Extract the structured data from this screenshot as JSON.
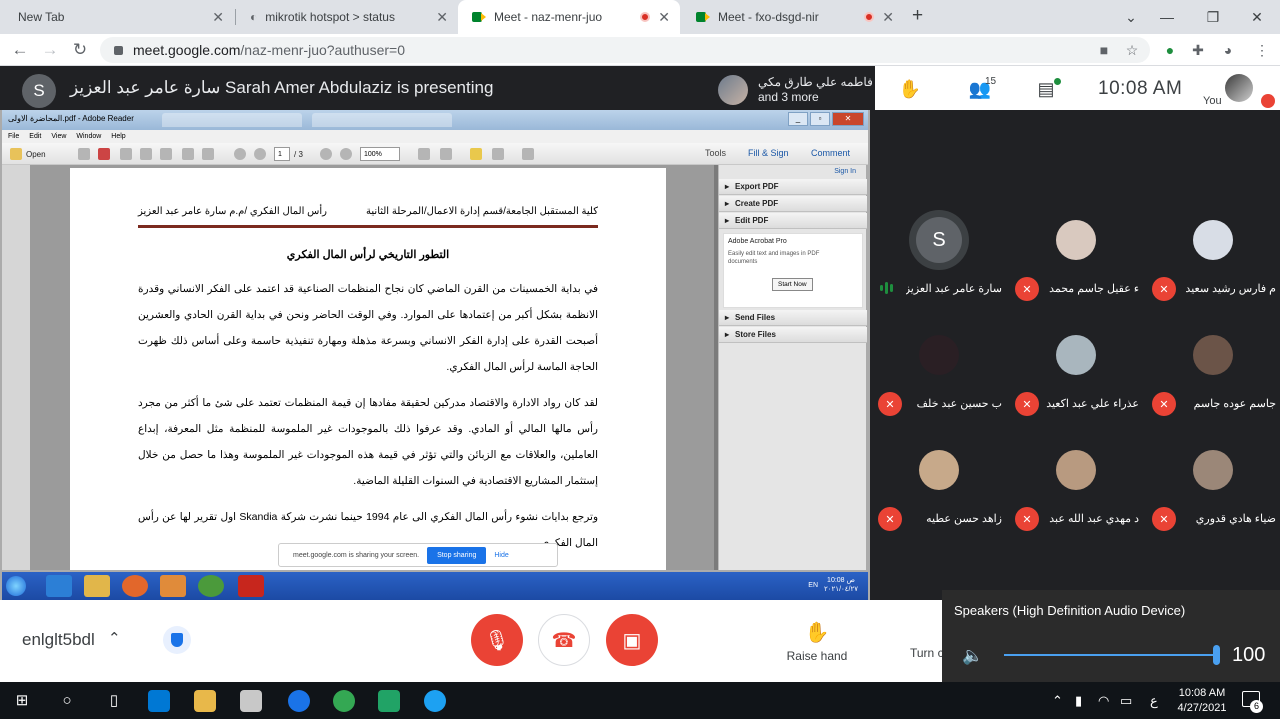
{
  "browser": {
    "tabs": [
      {
        "title": "New Tab",
        "active": false
      },
      {
        "title": "mikrotik hotspot > status",
        "active": false
      },
      {
        "title": "Meet - naz-menr-juo",
        "active": true,
        "recording": true
      },
      {
        "title": "Meet - fxo-dsgd-nir",
        "active": false,
        "recording": true
      }
    ],
    "new_tab_symbol": "+",
    "url_host": "meet.google.com",
    "url_path": "/naz-menr-juo?authuser=0"
  },
  "meet": {
    "presenter_initial": "S",
    "presenting_text": "سارة عامر عبد العزيز Sarah Amer Abdulaziz is presenting",
    "others_line1": "فاطمه علي طارق مكي",
    "others_line2": "and 3 more",
    "participant_count": "15",
    "clock": "10:08 AM",
    "you_label": "You"
  },
  "shared_screen": {
    "window_title": "المحاضرة الاولى.pdf - Adobe Reader",
    "menu": [
      "File",
      "Edit",
      "View",
      "Window",
      "Help"
    ],
    "open_label": "Open",
    "page_current": "1",
    "page_total": "/ 3",
    "zoom": "100%",
    "tools_label": "Tools",
    "fill_sign_label": "Fill & Sign",
    "comment_label": "Comment",
    "sign_in": "Sign In",
    "panel_items": [
      "Export PDF",
      "Create PDF",
      "Edit PDF",
      "Send Files",
      "Store Files"
    ],
    "acrobat_title": "Adobe Acrobat Pro",
    "acrobat_desc": "Easily edit text and images in PDF documents",
    "start_now": "Start Now",
    "doc_header_right": "كلية المستقبل الجامعة/قسم إدارة الاعمال/المرحلة الثانية",
    "doc_header_left": "رأس المال الفكري /م.م سارة عامر عبد العزيز",
    "doc_heading": "التطور التاريخي لرأس المال الفكري",
    "para1": "في بداية الخمسينات من القرن الماضي كان نجاح المنظمات الصناعية قد اعتمد على الفكر الانساني وقدرة الانظمة بشكل أكبر من إعتمادها على الموارد. وفي الوقت الحاضر ونحن في بداية القرن الحادي والعشرين أصبحت القدرة على إدارة الفكر الانساني وبسرعة مذهلة ومهارة تنفيذية حاسمة وعلى أساس ذلك ظهرت الحاجة الماسة لرأس المال الفكري.",
    "para2": "لقد كان رواد الادارة والاقتصاد مدركين لحقيقة مفادها إن قيمة المنظمات تعتمد على شئ ما أكثر من مجرد رأس مالها المالي أو المادي. وقد عرفوا ذلك بالموجودات غير الملموسة للمنظمة مثل المعرفة، إبداع العاملين، والعلاقات مع الزبائن والتي تؤثر في قيمة هذه الموجودات غير الملموسة وهذا ما حصل من خلال إستثمار المشاريع الاقتصادية في السنوات القليلة الماضية.",
    "para3": "وترجع بدايات نشوء رأس المال الفكري الى عام 1994 حينما نشرت شركة Skandia اول تقرير لها عن رأس المال الفكري",
    "share_notice": "meet.google.com is sharing your screen.",
    "stop_sharing": "Stop sharing",
    "hide": "Hide",
    "xp_lang": "EN",
    "xp_time": "10:08 ص",
    "xp_date": "٢٠٢١/٠٤/٢٧"
  },
  "participants": [
    {
      "name": "سارة عامر عبد العزيز",
      "letter": "S",
      "speaking": true,
      "muted": false,
      "photo_color": "#5f6368"
    },
    {
      "name": "ء عقيل جاسم محمد",
      "letter": "",
      "speaking": false,
      "muted": true,
      "photo_color": "#d9c9bf"
    },
    {
      "name": "م فارس رشيد سعيد",
      "letter": "",
      "speaking": false,
      "muted": true,
      "photo_color": "#d8dde6"
    },
    {
      "name": "ب حسين عبد خلف",
      "letter": "",
      "speaking": false,
      "muted": true,
      "photo_color": "#2a1f24"
    },
    {
      "name": "عذراء علي عبد اكعيد",
      "letter": "",
      "speaking": false,
      "muted": true,
      "photo_color": "#a9b6be"
    },
    {
      "name": "جاسم عوده جاسم",
      "letter": "",
      "speaking": false,
      "muted": true,
      "photo_color": "#6b5448"
    },
    {
      "name": "زاهد حسن عطيه",
      "letter": "",
      "speaking": false,
      "muted": true,
      "photo_color": "#c7a98a"
    },
    {
      "name": "د مهدي عبد الله عبد",
      "letter": "",
      "speaking": false,
      "muted": true,
      "photo_color": "#b89a80"
    },
    {
      "name": "ضياء هادي قدوري",
      "letter": "",
      "speaking": false,
      "muted": true,
      "photo_color": "#9b8778"
    }
  ],
  "controls": {
    "meeting_code": "enlglt5bdl",
    "raise_hand": "Raise hand",
    "turn_label": "Turn c"
  },
  "volume": {
    "device": "Speakers (High Definition Audio Device)",
    "level": 100
  },
  "taskbar": {
    "time": "10:08 AM",
    "date": "4/27/2021",
    "notif_count": "6",
    "ime": "ع"
  }
}
